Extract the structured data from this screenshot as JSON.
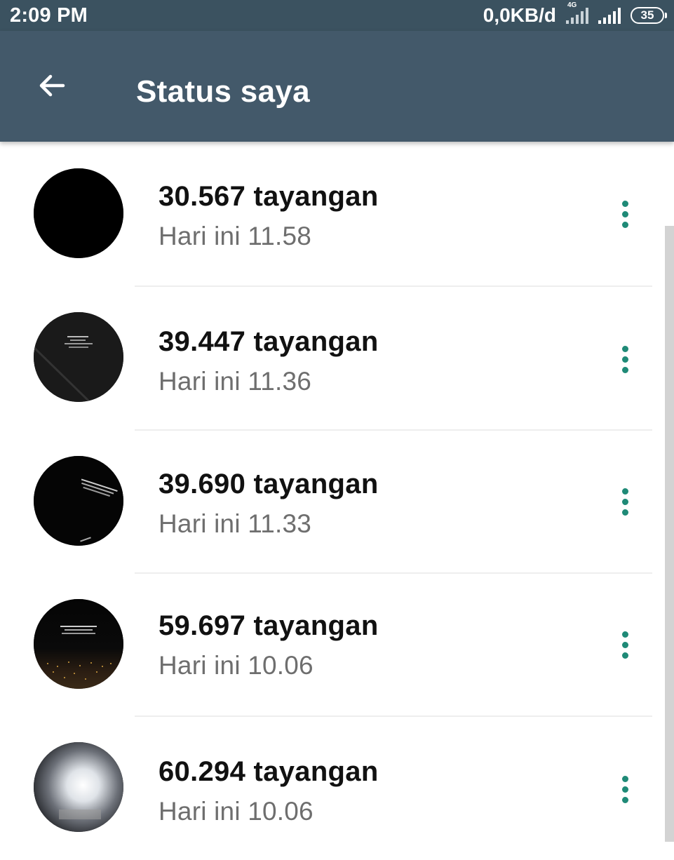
{
  "status_bar": {
    "time": "2:09 PM",
    "network_speed": "0,0KB/d",
    "signal_label": "4G",
    "battery": "35"
  },
  "header": {
    "title": "Status saya"
  },
  "statuses": [
    {
      "views": "30.567 tayangan",
      "time": "Hari ini 11.58",
      "thumbnail": "black"
    },
    {
      "views": "39.447 tayangan",
      "time": "Hari ini 11.36",
      "thumbnail": "dark text image"
    },
    {
      "views": "39.690 tayangan",
      "time": "Hari ini 11.33",
      "thumbnail": "dark text image"
    },
    {
      "views": "59.697 tayangan",
      "time": "Hari ini 10.06",
      "thumbnail": "night city image"
    },
    {
      "views": "60.294 tayangan",
      "time": "Hari ini 10.06",
      "thumbnail": "light blur image"
    }
  ],
  "colors": {
    "status_bar": "#3b5260",
    "app_bar": "#43596a",
    "accent": "#1f8a77"
  }
}
